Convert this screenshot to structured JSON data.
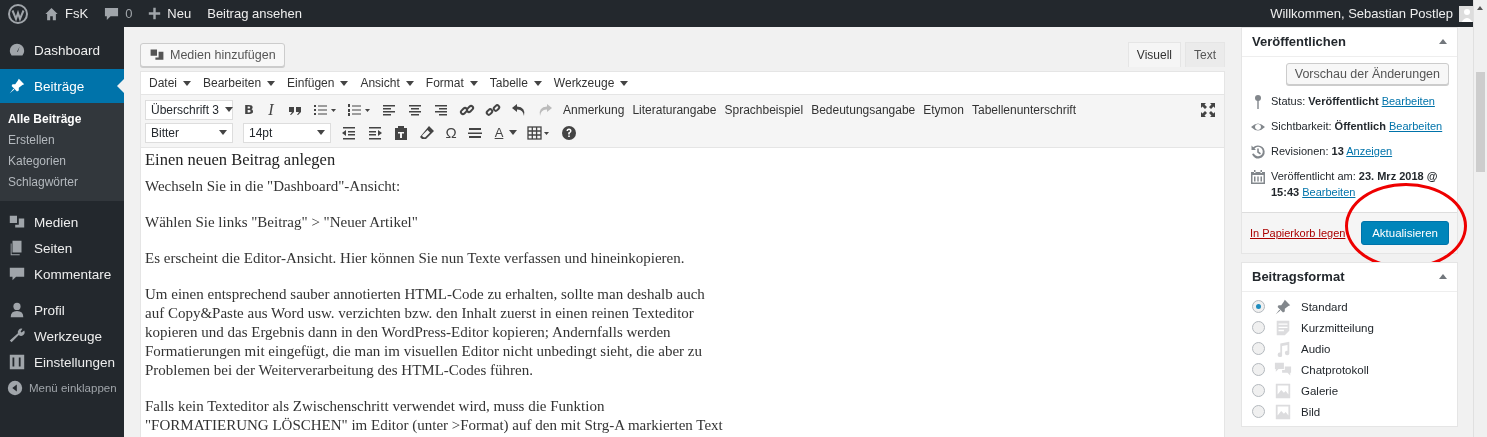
{
  "admin_bar": {
    "site": "FsK",
    "comments": "0",
    "new": "Neu",
    "view_post": "Beitrag ansehen",
    "greeting": "Willkommen, Sebastian Postlep"
  },
  "sidebar": {
    "items": [
      {
        "label": "Dashboard",
        "selected": false
      },
      {
        "label": "Beiträge",
        "selected": true,
        "children": [
          {
            "label": "Alle Beiträge",
            "selected": true
          },
          {
            "label": "Erstellen",
            "selected": false
          },
          {
            "label": "Kategorien",
            "selected": false
          },
          {
            "label": "Schlagwörter",
            "selected": false
          }
        ]
      },
      {
        "label": "Medien",
        "selected": false
      },
      {
        "label": "Seiten",
        "selected": false
      },
      {
        "label": "Kommentare",
        "selected": false
      },
      {
        "label": "Profil",
        "selected": false
      },
      {
        "label": "Werkzeuge",
        "selected": false
      },
      {
        "label": "Einstellungen",
        "selected": false
      }
    ],
    "collapse": "Menü einklappen"
  },
  "editor": {
    "add_media": "Medien hinzufügen",
    "tabs": [
      {
        "label": "Visuell",
        "selected": true
      },
      {
        "label": "Text",
        "selected": false
      }
    ],
    "menu": [
      "Datei",
      "Bearbeiten",
      "Einfügen",
      "Ansicht",
      "Format",
      "Tabelle",
      "Werkzeuge"
    ],
    "toolbar_1": {
      "format_select": "Überschrift 3",
      "bold": "B",
      "italic": "I",
      "redo_disabled": true,
      "text_buttons": [
        "Anmerkung",
        "Literaturangabe",
        "Sprachbeispiel",
        "Bedeutungsangabe",
        "Etymon",
        "Tabellenunterschrift"
      ]
    },
    "toolbar_2": {
      "font_select": "Bitter",
      "size_select": "14pt",
      "special_char": "Ω",
      "text_color": "A"
    },
    "content": {
      "heading": "Einen neuen Beitrag anlegen",
      "paragraphs": [
        [
          "Wechseln Sie in die \"Dashboard\"-Ansicht:"
        ],
        [
          "Wählen Sie links \"Beitrag\" > \"Neuer Artikel\""
        ],
        [
          "Es erscheint die Editor-Ansicht. Hier können Sie nun Texte verfassen und hineinkopieren."
        ],
        [
          "Um einen entsprechend sauber annotierten HTML-Code zu erhalten, sollte man deshalb auch",
          "auf Copy&Paste aus Word usw. verzichten bzw. den Inhalt zuerst in einen reinen Texteditor",
          "kopieren und das Ergebnis dann in den WordPress-Editor kopieren; Andernfalls werden",
          "Formatierungen mit eingefügt, die man im visuellen Editor nicht unbedingt sieht, die aber zu",
          "Problemen bei der Weiterverarbeitung des HTML-Codes führen."
        ],
        [
          "Falls kein Texteditor als Zwischenschritt verwendet wird, muss die Funktion",
          "\"FORMATIERUNG LÖSCHEN\" im Editor (unter >Format) auf den mit Strg-A markierten Text"
        ]
      ]
    }
  },
  "publish": {
    "title": "Veröffentlichen",
    "preview": "Vorschau der Änderungen",
    "rows": [
      {
        "text": "Status: **Veröffentlicht**",
        "link": "Bearbeiten"
      },
      {
        "text": "Sichtbarkeit: **Öffentlich**",
        "link": "Bearbeiten"
      },
      {
        "text": "Revisionen: **13**",
        "link": "Anzeigen"
      },
      {
        "text": "Veröffentlicht am: **23. Mrz 2018 @ 15:43**",
        "link": "Bearbeiten"
      }
    ],
    "trash": "In Papierkorb legen",
    "update": "Aktualisieren"
  },
  "post_format": {
    "title": "Beitragsformat",
    "options": [
      {
        "label": "Standard",
        "selected": true
      },
      {
        "label": "Kurzmitteilung",
        "selected": false
      },
      {
        "label": "Audio",
        "selected": false
      },
      {
        "label": "Chatprotokoll",
        "selected": false
      },
      {
        "label": "Galerie",
        "selected": false
      },
      {
        "label": "Bild",
        "selected": false
      }
    ]
  }
}
